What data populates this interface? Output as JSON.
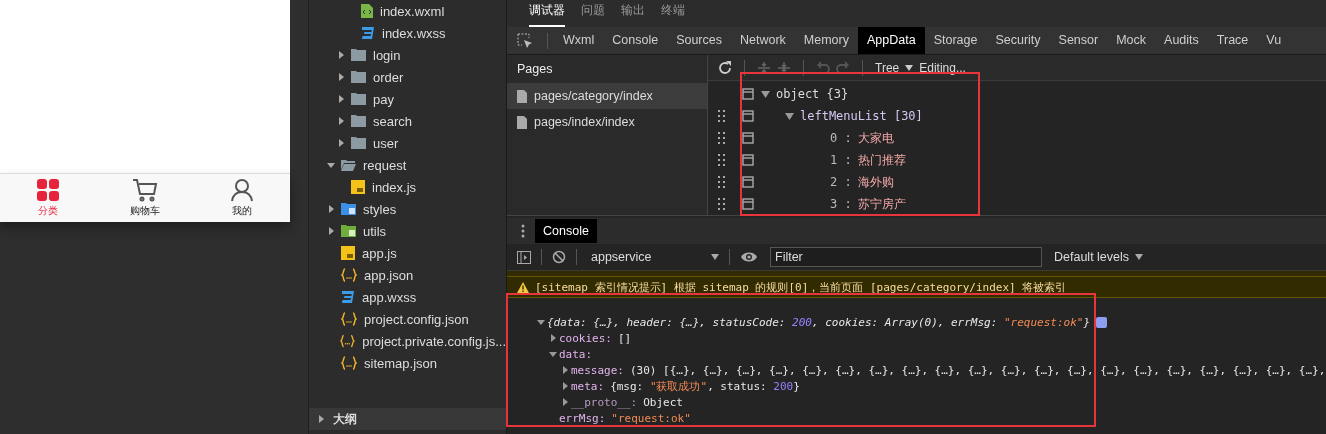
{
  "simulator": {
    "tabbar": [
      {
        "label": "分类",
        "kind": "grid",
        "selected": true
      },
      {
        "label": "购物车",
        "kind": "cart",
        "selected": false
      },
      {
        "label": "我的",
        "kind": "person",
        "selected": false
      }
    ]
  },
  "files": [
    {
      "kind": "hidden",
      "children": [
        {
          "kind": "hidden",
          "children": [
            {
              "name": "index.wxml",
              "kind": "wxml"
            },
            {
              "name": "index.wxss",
              "kind": "wxss"
            }
          ]
        },
        {
          "name": "login",
          "kind": "folder",
          "expanded": false
        },
        {
          "name": "order",
          "kind": "folder",
          "expanded": false
        },
        {
          "name": "pay",
          "kind": "folder",
          "expanded": false
        },
        {
          "name": "search",
          "kind": "folder",
          "expanded": false
        },
        {
          "name": "user",
          "kind": "folder",
          "expanded": false
        }
      ]
    },
    {
      "name": "request",
      "kind": "folder",
      "expanded": true,
      "children": [
        {
          "name": "index.js",
          "kind": "js"
        }
      ]
    },
    {
      "name": "styles",
      "kind": "styles",
      "expanded": false
    },
    {
      "name": "utils",
      "kind": "utils",
      "expanded": false
    },
    {
      "name": "app.js",
      "kind": "js"
    },
    {
      "name": "app.json",
      "kind": "json"
    },
    {
      "name": "app.wxss",
      "kind": "wxss"
    },
    {
      "name": "project.config.json",
      "kind": "json"
    },
    {
      "name": "project.private.config.js...",
      "kind": "json"
    },
    {
      "name": "sitemap.json",
      "kind": "json"
    }
  ],
  "outline": {
    "title": "大纲",
    "expanded": false
  },
  "devtools": {
    "top_tabs": [
      {
        "label": "调试器",
        "selected": true
      },
      {
        "label": "问题",
        "selected": false
      },
      {
        "label": "输出",
        "selected": false
      },
      {
        "label": "终端",
        "selected": false
      }
    ],
    "tool_tabs": [
      {
        "label": "Wxml",
        "selected": false
      },
      {
        "label": "Console",
        "selected": false
      },
      {
        "label": "Sources",
        "selected": false
      },
      {
        "label": "Network",
        "selected": false
      },
      {
        "label": "Memory",
        "selected": false
      },
      {
        "label": "AppData",
        "selected": true
      },
      {
        "label": "Storage",
        "selected": false
      },
      {
        "label": "Security",
        "selected": false
      },
      {
        "label": "Sensor",
        "selected": false
      },
      {
        "label": "Mock",
        "selected": false
      },
      {
        "label": "Audits",
        "selected": false
      },
      {
        "label": "Trace",
        "selected": false
      },
      {
        "label": "Vu",
        "selected": false
      }
    ],
    "appdata": {
      "pages_title": "Pages",
      "pages": [
        {
          "label": "pages/category/index",
          "selected": true
        },
        {
          "label": "pages/index/index",
          "selected": false
        }
      ],
      "view": "Tree",
      "mode": "Editing...",
      "tree": [
        {
          "key": "object",
          "count": "{3}",
          "expanded": true,
          "children": [
            {
              "key": "leftMenuList",
              "count": "[30]",
              "expanded": true,
              "children": [
                {
                  "key": "0 :",
                  "value": "大家电"
                },
                {
                  "key": "1 :",
                  "value": "热门推荐"
                },
                {
                  "key": "2 :",
                  "value": "海外购"
                },
                {
                  "key": "3 :",
                  "value": "苏宁房产"
                }
              ]
            }
          ]
        }
      ]
    },
    "console": {
      "tab": "Console",
      "context": "appservice",
      "filter": {
        "placeholder": "Filter"
      },
      "levels": "Default levels",
      "warning": "[sitemap 索引情况提示] 根据 sitemap 的规则[0]，当前页面 [pages/category/index] 将被索引",
      "log": [
        {
          "kind": "summary",
          "expanded": true,
          "parts": [
            {
              "text": "{data: {…}, header: {…}, statusCode: ",
              "kind": "plain"
            },
            {
              "text": "200",
              "kind": "number"
            },
            {
              "text": ", cookies: Array(0), errMsg: ",
              "kind": "plain"
            },
            {
              "text": "\"request:ok\"",
              "kind": "string"
            },
            {
              "text": "}",
              "kind": "plain"
            }
          ],
          "children": [
            {
              "key": "cookies:",
              "expanded": false,
              "parts": [
                {
                  "text": "[]",
                  "kind": "plain"
                }
              ]
            },
            {
              "key": "data:",
              "expanded": true,
              "children": [
                {
                  "key": "message:",
                  "expanded": false,
                  "parts": [
                    {
                      "text": "(30) [{…}, {…}, {…}, {…}, {…}, {…}, {…}, {…}, {…}, {…}, {…}, {…}, {…}, {…}, {…}, {…}, {…}, {…}, {…}, {…},",
                      "kind": "plain"
                    }
                  ]
                },
                {
                  "key": "meta:",
                  "expanded": false,
                  "parts": [
                    {
                      "text": "{msg: ",
                      "kind": "plain"
                    },
                    {
                      "text": "\"获取成功\"",
                      "kind": "string"
                    },
                    {
                      "text": ", status: ",
                      "kind": "plain"
                    },
                    {
                      "text": "200",
                      "kind": "number"
                    },
                    {
                      "text": "}",
                      "kind": "plain"
                    }
                  ]
                },
                {
                  "key": "__proto__:",
                  "expanded": false,
                  "dim": true,
                  "parts": [
                    {
                      "text": "Object",
                      "kind": "plain"
                    }
                  ]
                }
              ]
            },
            {
              "key": "errMsg:",
              "parts": [
                {
                  "text": "\"request:ok\"",
                  "kind": "string"
                }
              ]
            }
          ]
        }
      ]
    }
  }
}
